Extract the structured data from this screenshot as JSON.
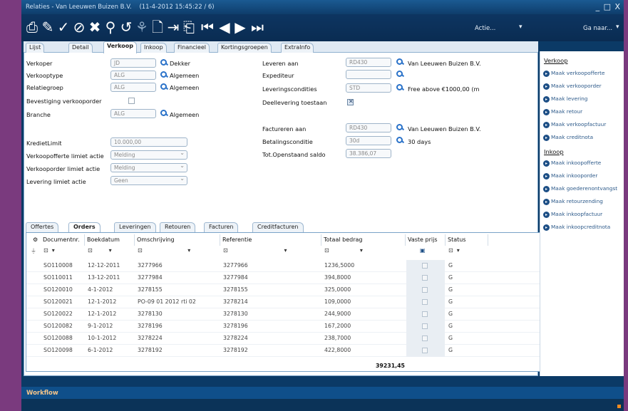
{
  "window": {
    "title": "Relaties - Van Leeuwen Buizen B.V.",
    "timestamp": "(11-4-2012 15:45:22 / 6)",
    "controls": "_ □ X"
  },
  "toolbar": {
    "actie_label": "Actie...",
    "ganaar_label": "Ga naar..."
  },
  "tabs": [
    "Lijst",
    "Detail",
    "Verkoop",
    "Inkoop",
    "Financieel",
    "Kortingsgroepen",
    "ExtraInfo"
  ],
  "form": {
    "left": {
      "verkoper_label": "Verkoper",
      "verkoper_code": "JD",
      "verkoper_name": "Dekker",
      "verkooptype_label": "Verkooptype",
      "verkooptype_code": "ALG",
      "verkooptype_name": "Algemeen",
      "relatiegroep_label": "Relatiegroep",
      "relatiegroep_code": "ALG",
      "relatiegroep_name": "Algemeen",
      "bevestiging_label": "Bevestiging verkooporder",
      "branche_label": "Branche",
      "branche_code": "ALG",
      "branche_name": "Algemeen",
      "kredietlimit_label": "KredietLimit",
      "kredietlimit_value": "10.000,00",
      "vo_limiet_label": "Verkoopofferte limiet actie",
      "vo_limiet_value": "Melding",
      "vord_limiet_label": "Verkooporder limiet actie",
      "vord_limiet_value": "Melding",
      "lev_limiet_label": "Levering limiet actie",
      "lev_limiet_value": "Geen"
    },
    "right": {
      "leveren_label": "Leveren aan",
      "leveren_code": "RD430",
      "leveren_name": "Van Leeuwen Buizen B.V.",
      "expediteur_label": "Expediteur",
      "expediteur_code": "",
      "leveringscond_label": "Leveringscondities",
      "leveringscond_code": "STD",
      "leveringscond_name": "Free above  €1000,00 (m",
      "deellevering_label": "Deellevering toestaan",
      "factureren_label": "Factureren aan",
      "factureren_code": "RD430",
      "factureren_name": "Van Leeuwen Buizen B.V.",
      "betaling_label": "Betalingsconditie",
      "betaling_code": "30d",
      "betaling_name": "30 days",
      "openstaand_label": "Tot.Openstaand saldo",
      "openstaand_value": "38.386,07"
    }
  },
  "bottom_tabs": [
    "Offertes",
    "Orders",
    "Leveringen",
    "Retouren",
    "Facturen",
    "Creditfacturen"
  ],
  "grid": {
    "columns": [
      "Documentnr.",
      "Boekdatum",
      "Omschrijving",
      "Referentie",
      "Totaal bedrag",
      "Vaste prijs",
      "Status"
    ],
    "rows": [
      [
        "SO110008",
        "12-12-2011",
        "3277966",
        "3277966",
        "1236,5000",
        "G"
      ],
      [
        "SO110011",
        "13-12-2011",
        "3277984",
        "3277984",
        "394,8000",
        "G"
      ],
      [
        "SO120010",
        "4-1-2012",
        "3278155",
        "3278155",
        "325,0000",
        "G"
      ],
      [
        "SO120021",
        "12-1-2012",
        "PO-09 01 2012 rti 02",
        "3278214",
        "109,0000",
        "G"
      ],
      [
        "SO120022",
        "12-1-2012",
        "3278130",
        "3278130",
        "244,9000",
        "G"
      ],
      [
        "SO120082",
        "9-1-2012",
        "3278196",
        "3278196",
        "167,2000",
        "G"
      ],
      [
        "SO120088",
        "10-1-2012",
        "3278224",
        "3278224",
        "238,7000",
        "G"
      ],
      [
        "SO120098",
        "6-1-2012",
        "3278192",
        "3278192",
        "422,8000",
        "G"
      ]
    ],
    "total": "39231,45"
  },
  "right_panel": {
    "verkoop_title": "Verkoop",
    "verkoop_items": [
      "Maak verkoopofferte",
      "Maak verkooporder",
      "Maak levering",
      "Maak retour",
      "Maak verkoopfactuur",
      "Maak creditnota"
    ],
    "inkoop_title": "Inkoop",
    "inkoop_items": [
      "Maak inkoopofferte",
      "Maak inkooporder",
      "Maak goederenontvangst",
      "Maak retourzending",
      "Maak inkoopfactuur",
      "Maak inkoopcreditnota"
    ]
  },
  "statusbar": {
    "workflow_label": "Workflow"
  }
}
